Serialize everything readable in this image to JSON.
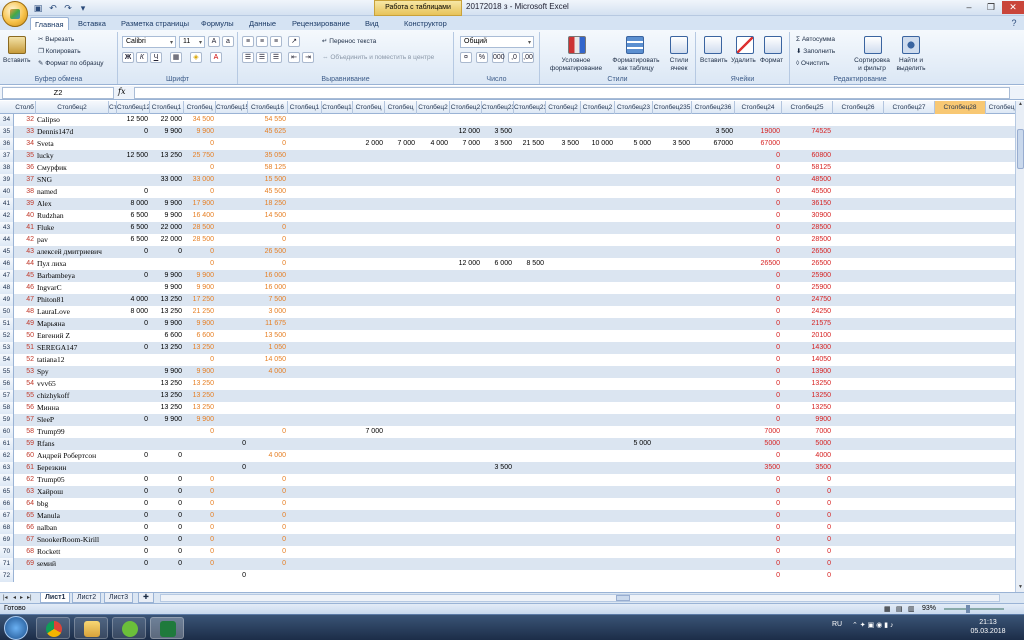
{
  "titlebar": {
    "context_tab": "Работа с таблицами",
    "window_title": "20172018 з - Microsoft Excel"
  },
  "tabs": [
    "Главная",
    "Вставка",
    "Разметка страницы",
    "Формулы",
    "Данные",
    "Рецензирование",
    "Вид",
    "Конструктор"
  ],
  "ribbon": {
    "paste": "Вставить",
    "cut": "Вырезать",
    "copy": "Копировать",
    "format_painter": "Формат по образцу",
    "clipboard": "Буфер обмена",
    "font_name": "Calibri",
    "font_size": "11",
    "font_group": "Шрифт",
    "wrap": "Перенос текста",
    "merge": "Объединить и поместить в центре",
    "align_group": "Выравнивание",
    "number_format": "Общий",
    "number_group": "Число",
    "cond_format": "Условное форматирование",
    "format_table": "Форматировать как таблицу",
    "cell_styles": "Стили ячеек",
    "styles_group": "Стили",
    "insert": "Вставить",
    "delete": "Удалить",
    "format": "Формат",
    "cells_group": "Ячейки",
    "autosum": "Автосумма",
    "fill": "Заполнить",
    "clear": "Очистить",
    "sort": "Сортировка и фильтр",
    "find": "Найти и выделить",
    "edit_group": "Редактирование"
  },
  "formula": {
    "namebox": "Z2",
    "fx": "fx"
  },
  "columns": [
    "Столб",
    "Столбец2",
    "Ст",
    "Столбец12",
    "Столбец1",
    "Столбец",
    "Столбец15",
    "Столбец16",
    "Столбец1",
    "Столбец1",
    "Столбец",
    "Столбец",
    "Столбец2",
    "Столбец2",
    "Столбец23",
    "Столбец23",
    "Столбец2",
    "Столбец2",
    "Столбец23",
    "Столбец235",
    "Столбец236",
    "Столбец24",
    "Столбец25",
    "Столбец26",
    "Столбец27",
    "Столбец28",
    "Столбец"
  ],
  "rows": [
    {
      "n": "34",
      "i": "32",
      "name": "Calipso",
      "v": [
        "",
        "12 500",
        "22 000",
        "34 500",
        "",
        "54 550",
        "",
        "",
        "",
        "",
        "",
        "",
        "",
        "",
        "",
        "",
        "",
        "",
        "",
        "",
        "",
        "89050"
      ]
    },
    {
      "n": "35",
      "i": "33",
      "name": "Dennis147d",
      "v": [
        "",
        "0",
        "9 900",
        "9 900",
        "",
        "45 625",
        "",
        "",
        "",
        "",
        "",
        "12 000",
        "3 500",
        "",
        "",
        "",
        "",
        "",
        "3 500",
        "19000",
        "74525"
      ]
    },
    {
      "n": "36",
      "i": "34",
      "name": "Sveta",
      "v": [
        "",
        "",
        "",
        "0",
        "",
        "0",
        "",
        "",
        "2 000",
        "7 000",
        "4 000",
        "7 000",
        "3 500",
        "21 500",
        "3 500",
        "10 000",
        "5 000",
        "3 500",
        "67000",
        "67000"
      ]
    },
    {
      "n": "37",
      "i": "35",
      "name": "lucky",
      "v": [
        "",
        "12 500",
        "13 250",
        "25 750",
        "",
        "35 050",
        "",
        "",
        "",
        "",
        "",
        "",
        "",
        "",
        "",
        "",
        "",
        "",
        "",
        "0",
        "60800"
      ]
    },
    {
      "n": "38",
      "i": "36",
      "name": "Смурфик",
      "v": [
        "",
        "",
        "",
        "0",
        "",
        "58 125",
        "",
        "",
        "",
        "",
        "",
        "",
        "",
        "",
        "",
        "",
        "",
        "",
        "",
        "0",
        "58125"
      ]
    },
    {
      "n": "39",
      "i": "37",
      "name": "SNG",
      "v": [
        "",
        "",
        "33 000",
        "33 000",
        "",
        "15 500",
        "",
        "",
        "",
        "",
        "",
        "",
        "",
        "",
        "",
        "",
        "",
        "",
        "",
        "0",
        "48500"
      ]
    },
    {
      "n": "40",
      "i": "38",
      "name": "named",
      "v": [
        "",
        "0",
        "",
        "0",
        "",
        "45 500",
        "",
        "",
        "",
        "",
        "",
        "",
        "",
        "",
        "",
        "",
        "",
        "",
        "",
        "0",
        "45500"
      ]
    },
    {
      "n": "41",
      "i": "39",
      "name": "Alex",
      "v": [
        "",
        "8 000",
        "9 900",
        "17 900",
        "",
        "18 250",
        "",
        "",
        "",
        "",
        "",
        "",
        "",
        "",
        "",
        "",
        "",
        "",
        "",
        "0",
        "36150"
      ]
    },
    {
      "n": "42",
      "i": "40",
      "name": "Rudzhan",
      "v": [
        "",
        "6 500",
        "9 900",
        "16 400",
        "",
        "14 500",
        "",
        "",
        "",
        "",
        "",
        "",
        "",
        "",
        "",
        "",
        "",
        "",
        "",
        "0",
        "30900"
      ]
    },
    {
      "n": "43",
      "i": "41",
      "name": "Fluke",
      "v": [
        "",
        "6 500",
        "22 000",
        "28 500",
        "",
        "0",
        "",
        "",
        "",
        "",
        "",
        "",
        "",
        "",
        "",
        "",
        "",
        "",
        "",
        "0",
        "28500"
      ]
    },
    {
      "n": "44",
      "i": "42",
      "name": "pav",
      "v": [
        "",
        "6 500",
        "22 000",
        "28 500",
        "",
        "0",
        "",
        "",
        "",
        "",
        "",
        "",
        "",
        "",
        "",
        "",
        "",
        "",
        "",
        "0",
        "28500"
      ]
    },
    {
      "n": "45",
      "i": "43",
      "name": "алексей дмитриевич",
      "v": [
        "",
        "0",
        "0",
        "0",
        "",
        "26 500",
        "",
        "",
        "",
        "",
        "",
        "",
        "",
        "",
        "",
        "",
        "",
        "",
        "",
        "0",
        "26500"
      ]
    },
    {
      "n": "46",
      "i": "44",
      "name": "Пул лиха",
      "v": [
        "",
        "",
        "",
        "0",
        "",
        "0",
        "",
        "",
        "",
        "",
        "",
        "12 000",
        "6 000",
        "8 500",
        "",
        "",
        "",
        "",
        "",
        "26500",
        "26500"
      ]
    },
    {
      "n": "47",
      "i": "45",
      "name": "Barbambeya",
      "v": [
        "",
        "0",
        "9 900",
        "9 900",
        "",
        "16 000",
        "",
        "",
        "",
        "",
        "",
        "",
        "",
        "",
        "",
        "",
        "",
        "",
        "",
        "0",
        "25900"
      ]
    },
    {
      "n": "48",
      "i": "46",
      "name": "IngvarC",
      "v": [
        "",
        "",
        "9 900",
        "9 900",
        "",
        "16 000",
        "",
        "",
        "",
        "",
        "",
        "",
        "",
        "",
        "",
        "",
        "",
        "",
        "",
        "0",
        "25900"
      ]
    },
    {
      "n": "49",
      "i": "47",
      "name": "Phiton81",
      "v": [
        "",
        "4 000",
        "13 250",
        "17 250",
        "",
        "7 500",
        "",
        "",
        "",
        "",
        "",
        "",
        "",
        "",
        "",
        "",
        "",
        "",
        "",
        "0",
        "24750"
      ]
    },
    {
      "n": "50",
      "i": "48",
      "name": "LauraLove",
      "v": [
        "",
        "8 000",
        "13 250",
        "21 250",
        "",
        "3 000",
        "",
        "",
        "",
        "",
        "",
        "",
        "",
        "",
        "",
        "",
        "",
        "",
        "",
        "0",
        "24250"
      ]
    },
    {
      "n": "51",
      "i": "49",
      "name": "Марьяна",
      "v": [
        "",
        "0",
        "9 900",
        "9 900",
        "",
        "11 675",
        "",
        "",
        "",
        "",
        "",
        "",
        "",
        "",
        "",
        "",
        "",
        "",
        "",
        "0",
        "21575"
      ]
    },
    {
      "n": "52",
      "i": "50",
      "name": "Евгений Z",
      "v": [
        "",
        "",
        "6 600",
        "6 600",
        "",
        "13 500",
        "",
        "",
        "",
        "",
        "",
        "",
        "",
        "",
        "",
        "",
        "",
        "",
        "",
        "0",
        "20100"
      ]
    },
    {
      "n": "53",
      "i": "51",
      "name": "SEREGA147",
      "v": [
        "",
        "0",
        "13 250",
        "13 250",
        "",
        "1 050",
        "",
        "",
        "",
        "",
        "",
        "",
        "",
        "",
        "",
        "",
        "",
        "",
        "",
        "0",
        "14300"
      ]
    },
    {
      "n": "54",
      "i": "52",
      "name": "tatiana12",
      "v": [
        "",
        "",
        "",
        "0",
        "",
        "14 050",
        "",
        "",
        "",
        "",
        "",
        "",
        "",
        "",
        "",
        "",
        "",
        "",
        "",
        "0",
        "14050"
      ]
    },
    {
      "n": "55",
      "i": "53",
      "name": "Spy",
      "v": [
        "",
        "",
        "9 900",
        "9 900",
        "",
        "4 000",
        "",
        "",
        "",
        "",
        "",
        "",
        "",
        "",
        "",
        "",
        "",
        "",
        "",
        "0",
        "13900"
      ]
    },
    {
      "n": "56",
      "i": "54",
      "name": "vvv65",
      "v": [
        "",
        "",
        "13 250",
        "13 250",
        "",
        "",
        "",
        "",
        "",
        "",
        "",
        "",
        "",
        "",
        "",
        "",
        "",
        "",
        "",
        "0",
        "13250"
      ]
    },
    {
      "n": "57",
      "i": "55",
      "name": "chizhykoff",
      "v": [
        "",
        "",
        "13 250",
        "13 250",
        "",
        "",
        "",
        "",
        "",
        "",
        "",
        "",
        "",
        "",
        "",
        "",
        "",
        "",
        "",
        "0",
        "13250"
      ]
    },
    {
      "n": "58",
      "i": "56",
      "name": "Минна",
      "v": [
        "",
        "",
        "13 250",
        "13 250",
        "",
        "",
        "",
        "",
        "",
        "",
        "",
        "",
        "",
        "",
        "",
        "",
        "",
        "",
        "",
        "0",
        "13250"
      ]
    },
    {
      "n": "59",
      "i": "57",
      "name": "SleeP",
      "v": [
        "",
        "0",
        "9 900",
        "9 900",
        "",
        "",
        "",
        "",
        "",
        "",
        "",
        "",
        "",
        "",
        "",
        "",
        "",
        "",
        "",
        "0",
        "9900"
      ]
    },
    {
      "n": "60",
      "i": "58",
      "name": "Trump99",
      "v": [
        "",
        "",
        "",
        "0",
        "",
        "0",
        "",
        "",
        "7 000",
        "",
        "",
        "",
        "",
        "",
        "",
        "",
        "",
        "",
        "",
        "7000",
        "7000"
      ]
    },
    {
      "n": "61",
      "i": "59",
      "name": "Rfans",
      "v": [
        "",
        "",
        "",
        "",
        "0",
        "",
        "",
        "",
        "",
        "",
        "",
        "",
        "",
        "",
        "",
        "",
        "5 000",
        "",
        "",
        "5000",
        "5000"
      ]
    },
    {
      "n": "62",
      "i": "60",
      "name": "Андрей Робертсон",
      "v": [
        "",
        "0",
        "0",
        "",
        "",
        "4 000",
        "",
        "",
        "",
        "",
        "",
        "",
        "",
        "",
        "",
        "",
        "",
        "",
        "",
        "0",
        "4000"
      ]
    },
    {
      "n": "63",
      "i": "61",
      "name": "Березкин",
      "v": [
        "",
        "",
        "",
        "",
        "0",
        "",
        "",
        "",
        "",
        "",
        "",
        "",
        "3 500",
        "",
        "",
        "",
        "",
        "",
        "",
        "3500",
        "3500"
      ]
    },
    {
      "n": "64",
      "i": "62",
      "name": "Trump05",
      "v": [
        "",
        "0",
        "0",
        "0",
        "",
        "0",
        "",
        "",
        "",
        "",
        "",
        "",
        "",
        "",
        "",
        "",
        "",
        "",
        "",
        "0",
        "0"
      ]
    },
    {
      "n": "65",
      "i": "63",
      "name": "Хайрош",
      "v": [
        "",
        "0",
        "0",
        "0",
        "",
        "0",
        "",
        "",
        "",
        "",
        "",
        "",
        "",
        "",
        "",
        "",
        "",
        "",
        "",
        "0",
        "0"
      ]
    },
    {
      "n": "66",
      "i": "64",
      "name": "bbg",
      "v": [
        "",
        "0",
        "0",
        "0",
        "",
        "0",
        "",
        "",
        "",
        "",
        "",
        "",
        "",
        "",
        "",
        "",
        "",
        "",
        "",
        "0",
        "0"
      ]
    },
    {
      "n": "67",
      "i": "65",
      "name": "Manula",
      "v": [
        "",
        "0",
        "0",
        "0",
        "",
        "0",
        "",
        "",
        "",
        "",
        "",
        "",
        "",
        "",
        "",
        "",
        "",
        "",
        "",
        "0",
        "0"
      ]
    },
    {
      "n": "68",
      "i": "66",
      "name": "nalban",
      "v": [
        "",
        "0",
        "0",
        "0",
        "",
        "0",
        "",
        "",
        "",
        "",
        "",
        "",
        "",
        "",
        "",
        "",
        "",
        "",
        "",
        "0",
        "0"
      ]
    },
    {
      "n": "69",
      "i": "67",
      "name": "SnookerRoom-Kirill",
      "v": [
        "",
        "0",
        "0",
        "0",
        "",
        "0",
        "",
        "",
        "",
        "",
        "",
        "",
        "",
        "",
        "",
        "",
        "",
        "",
        "",
        "0",
        "0"
      ]
    },
    {
      "n": "70",
      "i": "68",
      "name": "Rockett",
      "v": [
        "",
        "0",
        "0",
        "0",
        "",
        "0",
        "",
        "",
        "",
        "",
        "",
        "",
        "",
        "",
        "",
        "",
        "",
        "",
        "",
        "0",
        "0"
      ]
    },
    {
      "n": "71",
      "i": "69",
      "name": "seмий",
      "v": [
        "",
        "0",
        "0",
        "0",
        "",
        "0",
        "",
        "",
        "",
        "",
        "",
        "",
        "",
        "",
        "",
        "",
        "",
        "",
        "",
        "0",
        "0"
      ]
    },
    {
      "n": "72",
      "i": "",
      "name": "",
      "v": [
        "",
        "",
        "",
        "",
        "0",
        "",
        "",
        "",
        "",
        "",
        "",
        "",
        "",
        "",
        "",
        "",
        "",
        "",
        "",
        "0",
        "0"
      ]
    }
  ],
  "sheets": [
    "Лист1",
    "Лист2",
    "Лист3"
  ],
  "status": {
    "ready": "Готово",
    "zoom": "93%"
  },
  "tray": {
    "lang": "RU",
    "time": "21:13",
    "date": "05.03.2018"
  }
}
